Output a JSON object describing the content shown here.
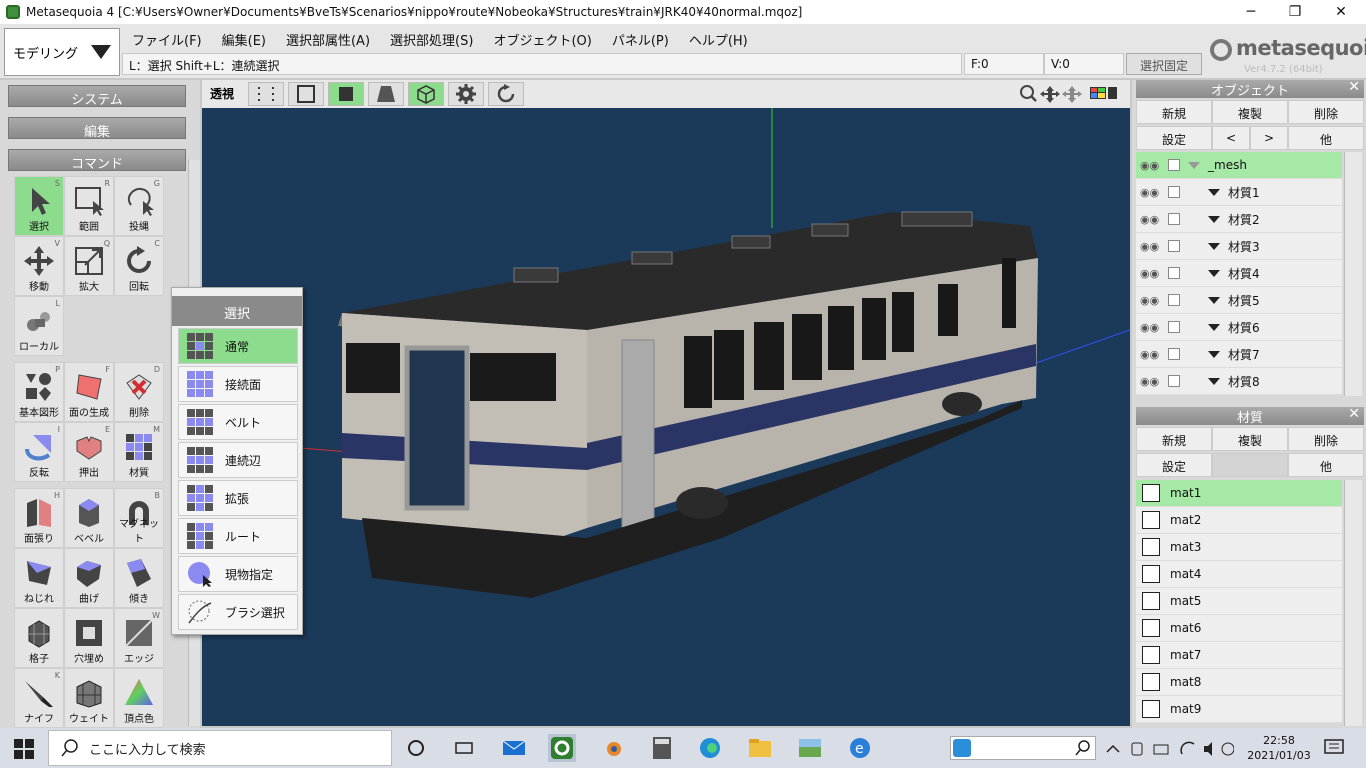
{
  "window": {
    "title": "Metasequoia 4 [C:¥Users¥Owner¥Documents¥BveTs¥Scenarios¥nippo¥route¥Nobeoka¥Structures¥train¥JRK40¥40normal.mqoz]",
    "minimize": "─",
    "maximize": "❐",
    "close": "✕"
  },
  "mode_button": "モデリング",
  "menu": [
    "ファイル(F)",
    "編集(E)",
    "選択部属性(A)",
    "選択部処理(S)",
    "オブジェクト(O)",
    "パネル(P)",
    "ヘルプ(H)"
  ],
  "hint": "L：選択  Shift+L：連続選択",
  "status": {
    "faces": "F:0",
    "vertices": "V:0",
    "select_fix": "選択固定"
  },
  "logo": {
    "name": "metasequoia",
    "num": "4",
    "version": "Ver4.7.2 (64bit)"
  },
  "left": {
    "sections": {
      "system": "システム",
      "edit": "編集",
      "command": "コマンド"
    },
    "tools1": [
      {
        "label": "選択",
        "key": "S"
      },
      {
        "label": "範囲",
        "key": "R"
      },
      {
        "label": "投縄",
        "key": "G"
      },
      {
        "label": "移動",
        "key": "V"
      },
      {
        "label": "拡大",
        "key": "Q"
      },
      {
        "label": "回転",
        "key": "C"
      },
      {
        "label": "ローカル",
        "key": "L"
      }
    ],
    "tools2": [
      {
        "label": "基本図形",
        "key": "P"
      },
      {
        "label": "面の生成",
        "key": "F"
      },
      {
        "label": "削除",
        "key": "D"
      },
      {
        "label": "反転",
        "key": "I"
      },
      {
        "label": "押出",
        "key": "E"
      },
      {
        "label": "材質",
        "key": "M"
      }
    ],
    "tools3": [
      {
        "label": "面張り",
        "key": "H"
      },
      {
        "label": "ベベル",
        "key": ""
      },
      {
        "label": "マグネット",
        "key": "B"
      },
      {
        "label": "ねじれ",
        "key": ""
      },
      {
        "label": "曲げ",
        "key": ""
      },
      {
        "label": "傾き",
        "key": ""
      },
      {
        "label": "格子",
        "key": ""
      },
      {
        "label": "穴埋め",
        "key": ""
      },
      {
        "label": "エッジ",
        "key": "W"
      },
      {
        "label": "ナイフ",
        "key": "K"
      },
      {
        "label": "ウェイト",
        "key": ""
      },
      {
        "label": "頂点色",
        "key": ""
      }
    ]
  },
  "viewport": {
    "label": "透視"
  },
  "popup": {
    "title": "選択",
    "items": [
      "通常",
      "接続面",
      "ベルト",
      "連続辺",
      "拡張",
      "ルート",
      "現物指定",
      "ブラシ選択"
    ]
  },
  "object_panel": {
    "title": "オブジェクト",
    "buttons": [
      "新規",
      "複製",
      "削除",
      "設定",
      "<",
      ">",
      "他"
    ],
    "rows": [
      "_mesh",
      "材質1",
      "材質2",
      "材質3",
      "材質4",
      "材質5",
      "材質6",
      "材質7",
      "材質8"
    ]
  },
  "material_panel": {
    "title": "材質",
    "buttons": [
      "新規",
      "複製",
      "削除",
      "設定",
      "他"
    ],
    "rows": [
      "mat1",
      "mat2",
      "mat3",
      "mat4",
      "mat5",
      "mat6",
      "mat7",
      "mat8",
      "mat9"
    ]
  },
  "taskbar": {
    "search_placeholder": "ここに入力して検索",
    "time": "22:58",
    "date": "2021/01/03"
  }
}
